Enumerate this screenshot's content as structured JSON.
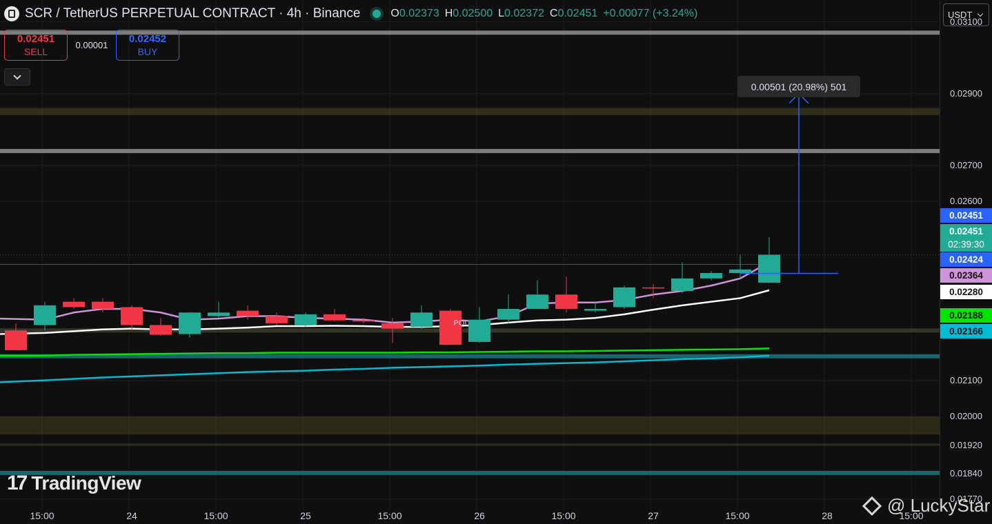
{
  "header": {
    "symbol": "SCR / TetherUS PERPETUAL CONTRACT · 4h · Binance",
    "ohlc": [
      {
        "key": "O",
        "value": "0.02373"
      },
      {
        "key": "H",
        "value": "0.02500"
      },
      {
        "key": "L",
        "value": "0.02372"
      },
      {
        "key": "C",
        "value": "0.02451"
      }
    ],
    "change": "+0.00077 (+3.24%)"
  },
  "trade": {
    "sell_price": "0.02451",
    "sell_label": "SELL",
    "spread": "0.00001",
    "buy_price": "0.02452",
    "buy_label": "BUY"
  },
  "currency": "USDT",
  "logo": "TradingView",
  "watermark": "@ LuckyStar",
  "measure": {
    "label": "0.00501 (20.98%) 501",
    "from": 0.02399,
    "to": 0.029
  },
  "colors": {
    "up": "#22ab94",
    "down": "#f23645",
    "background": "#0f0f0f"
  },
  "chart_data": {
    "type": "candlestick",
    "timeframe": "4h",
    "y_ticks": [
      "0.03100",
      "0.02900",
      "0.02700",
      "0.02600",
      "0.02100",
      "0.02000",
      "0.01920",
      "0.01840",
      "0.01770"
    ],
    "x_ticks": [
      "15:00",
      "24",
      "15:00",
      "25",
      "15:00",
      "26",
      "15:00",
      "27",
      "15:00",
      "28",
      "15:00"
    ],
    "ylim": [
      0.01739,
      0.03161
    ],
    "candles": [
      {
        "o": 0.0224,
        "h": 0.0226,
        "l": 0.02185,
        "c": 0.02185
      },
      {
        "o": 0.02255,
        "h": 0.0232,
        "l": 0.0224,
        "c": 0.0231
      },
      {
        "o": 0.0232,
        "h": 0.0233,
        "l": 0.023,
        "c": 0.02305
      },
      {
        "o": 0.0232,
        "h": 0.0233,
        "l": 0.0229,
        "c": 0.023
      },
      {
        "o": 0.02305,
        "h": 0.0231,
        "l": 0.0224,
        "c": 0.02255
      },
      {
        "o": 0.02255,
        "h": 0.02275,
        "l": 0.02225,
        "c": 0.02228
      },
      {
        "o": 0.0223,
        "h": 0.0229,
        "l": 0.0222,
        "c": 0.0229
      },
      {
        "o": 0.0228,
        "h": 0.0232,
        "l": 0.02275,
        "c": 0.0229
      },
      {
        "o": 0.02295,
        "h": 0.0231,
        "l": 0.0227,
        "c": 0.0228
      },
      {
        "o": 0.0228,
        "h": 0.0229,
        "l": 0.02255,
        "c": 0.0226
      },
      {
        "o": 0.02255,
        "h": 0.0229,
        "l": 0.0225,
        "c": 0.02285
      },
      {
        "o": 0.02285,
        "h": 0.023,
        "l": 0.02265,
        "c": 0.02268
      },
      {
        "o": 0.02268,
        "h": 0.02275,
        "l": 0.0226,
        "c": 0.02265
      },
      {
        "o": 0.0226,
        "h": 0.02275,
        "l": 0.02205,
        "c": 0.02245
      },
      {
        "o": 0.0225,
        "h": 0.0231,
        "l": 0.02245,
        "c": 0.0229
      },
      {
        "o": 0.02295,
        "h": 0.023,
        "l": 0.022,
        "c": 0.022
      },
      {
        "o": 0.02208,
        "h": 0.02305,
        "l": 0.02205,
        "c": 0.0227
      },
      {
        "o": 0.0227,
        "h": 0.0234,
        "l": 0.0226,
        "c": 0.023
      },
      {
        "o": 0.023,
        "h": 0.0238,
        "l": 0.023,
        "c": 0.0234
      },
      {
        "o": 0.0234,
        "h": 0.0239,
        "l": 0.0229,
        "c": 0.023
      },
      {
        "o": 0.02295,
        "h": 0.0232,
        "l": 0.0229,
        "c": 0.023
      },
      {
        "o": 0.02305,
        "h": 0.02365,
        "l": 0.023,
        "c": 0.0236
      },
      {
        "o": 0.0236,
        "h": 0.0237,
        "l": 0.0233,
        "c": 0.02357
      },
      {
        "o": 0.0235,
        "h": 0.0243,
        "l": 0.02345,
        "c": 0.02385
      },
      {
        "o": 0.02385,
        "h": 0.02405,
        "l": 0.0238,
        "c": 0.024
      },
      {
        "o": 0.024,
        "h": 0.0245,
        "l": 0.02385,
        "c": 0.0241
      },
      {
        "o": 0.02373,
        "h": 0.025,
        "l": 0.02372,
        "c": 0.02451
      }
    ],
    "last_price_timer": "02:39:30",
    "price_badges": [
      {
        "value": "0.02451",
        "bg": "#2962ff",
        "fg": "#ffffff"
      },
      {
        "value": "0.02451",
        "bg": "#22ab94",
        "fg": "#ffffff"
      },
      {
        "value": "0.02424",
        "bg": "#2962ff",
        "fg": "#ffffff"
      },
      {
        "value": "0.02364",
        "bg": "#ce93d8",
        "fg": "#131313"
      },
      {
        "value": "0.02280",
        "bg": "#ffffff",
        "fg": "#131313"
      },
      {
        "value": "0.02188",
        "bg": "#00e600",
        "fg": "#131313"
      },
      {
        "value": "0.02166",
        "bg": "#00bcd4",
        "fg": "#131313"
      }
    ],
    "moving_averages": [
      {
        "color": "#ce93d8",
        "values": [
          0.02273,
          0.0227,
          0.0229,
          0.023,
          0.023,
          0.0229,
          0.0227,
          0.02273,
          0.0228,
          0.0228,
          0.02275,
          0.02273,
          0.0227,
          0.02262,
          0.02265,
          0.0227,
          0.02265,
          0.0228,
          0.02315,
          0.02318,
          0.02318,
          0.02325,
          0.0234,
          0.0235,
          0.02365,
          0.02385,
          0.0243
        ]
      },
      {
        "color": "#ffffff",
        "values": [
          0.0223,
          0.02233,
          0.02238,
          0.02243,
          0.02245,
          0.02243,
          0.02243,
          0.02245,
          0.02248,
          0.02252,
          0.02252,
          0.02253,
          0.02252,
          0.0225,
          0.0225,
          0.02252,
          0.02255,
          0.02262,
          0.02268,
          0.0227,
          0.02275,
          0.02285,
          0.02298,
          0.0231,
          0.0232,
          0.0233,
          0.02352
        ]
      },
      {
        "color": "#00e600",
        "values": [
          0.0217,
          0.0217,
          0.02172,
          0.02173,
          0.02174,
          0.02175,
          0.02176,
          0.02177,
          0.02177,
          0.02178,
          0.02178,
          0.02178,
          0.02178,
          0.02178,
          0.02179,
          0.02179,
          0.0218,
          0.02181,
          0.02182,
          0.02182,
          0.02183,
          0.02184,
          0.02185,
          0.02186,
          0.02187,
          0.02188,
          0.0219
        ]
      },
      {
        "color": "#00bcd4",
        "values": [
          0.02096,
          0.02101,
          0.02105,
          0.02109,
          0.02112,
          0.02115,
          0.02118,
          0.02121,
          0.02124,
          0.02126,
          0.02128,
          0.02131,
          0.02133,
          0.02136,
          0.02138,
          0.0214,
          0.02142,
          0.02145,
          0.02147,
          0.02149,
          0.02151,
          0.02154,
          0.02157,
          0.0216,
          0.02162,
          0.02165,
          0.0217
        ]
      }
    ],
    "zones": [
      {
        "from": 0.0284,
        "to": 0.0286,
        "color": "rgba(110,105,45,0.35)"
      },
      {
        "from": 0.0195,
        "to": 0.02,
        "color": "rgba(110,105,45,0.30)"
      },
      {
        "from": 0.0192,
        "to": 0.01925,
        "color": "rgba(110,105,45,0.30)"
      }
    ],
    "levels": [
      {
        "value": 0.0307,
        "color": "#8a8a8a"
      },
      {
        "value": 0.0274,
        "color": "#8a8a8a"
      },
      {
        "value": 0.0224,
        "color": "#3a3a2a"
      },
      {
        "value": 0.02168,
        "color": "#1c6e78"
      },
      {
        "value": 0.01843,
        "color": "#1c6e78"
      }
    ],
    "annotation": "POI"
  }
}
